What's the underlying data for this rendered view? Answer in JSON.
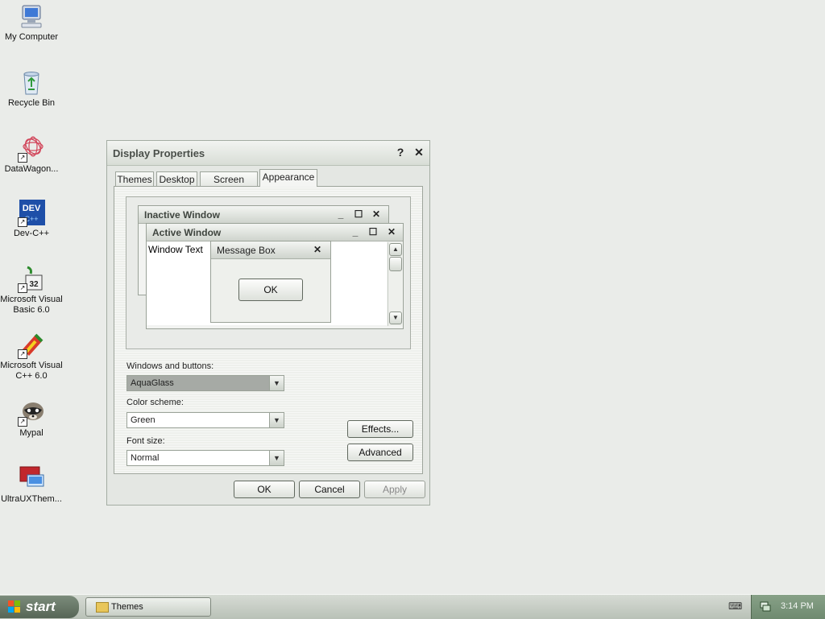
{
  "desktop": {
    "icons": [
      {
        "label": "My Computer"
      },
      {
        "label": "Recycle Bin"
      },
      {
        "label": "DataWagon..."
      },
      {
        "label": "Dev-C++"
      },
      {
        "label": "Microsoft Visual Basic 6.0"
      },
      {
        "label": "Microsoft Visual C++ 6.0"
      },
      {
        "label": "Mypal"
      },
      {
        "label": "UltraUXThem..."
      }
    ]
  },
  "dialog": {
    "title": "Display Properties",
    "help": "?",
    "close": "✕",
    "tabs": [
      {
        "label": "Themes"
      },
      {
        "label": "Desktop"
      },
      {
        "label": "Screen Saver"
      },
      {
        "label": "Appearance",
        "active": true
      }
    ],
    "preview": {
      "inactive_title": "Inactive Window",
      "active_title": "Active Window",
      "window_text": "Window Text",
      "message_box_title": "Message Box",
      "ok": "OK"
    },
    "windows_buttons_label": "Windows and buttons:",
    "windows_buttons_value": "AquaGlass",
    "color_scheme_label": "Color scheme:",
    "color_scheme_value": "Green",
    "font_size_label": "Font size:",
    "font_size_value": "Normal",
    "effects_label": "Effects...",
    "advanced_label": "Advanced",
    "ok_label": "OK",
    "cancel_label": "Cancel",
    "apply_label": "Apply"
  },
  "taskbar": {
    "start_label": "start",
    "task_label": "Themes",
    "clock": "3:14 PM"
  },
  "colors": {
    "desktop": "#eaece9",
    "taskbar_start": "#566556",
    "tray": "#6f8a70"
  }
}
